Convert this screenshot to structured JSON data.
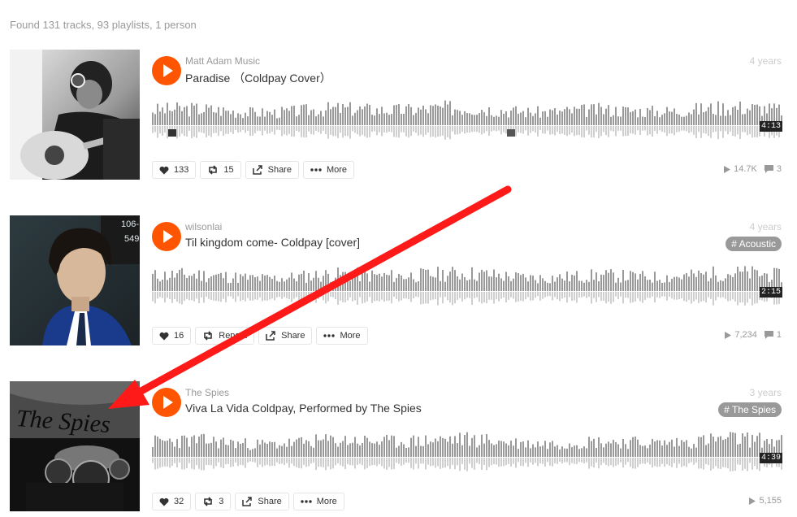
{
  "search": {
    "summary": "Found 131 tracks, 93 playlists, 1 person"
  },
  "tracks": [
    {
      "user": "Matt Adam Music",
      "title": "Paradise （Coldpay Cover）",
      "age": "4 years",
      "tag": "",
      "duration": "4:13",
      "likes": "133",
      "reposts": "15",
      "share": "Share",
      "more": "More",
      "plays": "14.7K",
      "comments": "3"
    },
    {
      "user": "wilsonlai",
      "title": "Til kingdom come- Coldpay [cover]",
      "age": "4 years",
      "tag": "# Acoustic",
      "duration": "2:15",
      "likes": "16",
      "reposts": "Repost",
      "share": "Share",
      "more": "More",
      "plays": "7,234",
      "comments": "1"
    },
    {
      "user": "The Spies",
      "title": "Viva La Vida Coldpay, Performed by The Spies",
      "age": "3 years",
      "tag": "# The Spies",
      "duration": "4:39",
      "likes": "32",
      "reposts": "3",
      "share": "Share",
      "more": "More",
      "plays": "5,155",
      "comments": ""
    }
  ],
  "artwork_text": {
    "band_logo": "The Spies",
    "side_number": "106-\n549"
  },
  "colors": {
    "accent": "#ff5500",
    "annotation": "#ff1a1a",
    "waveform": "#999999"
  },
  "icons": [
    "play-icon",
    "heart-icon",
    "repost-icon",
    "share-icon",
    "more-icon",
    "plays-icon",
    "comment-icon"
  ]
}
